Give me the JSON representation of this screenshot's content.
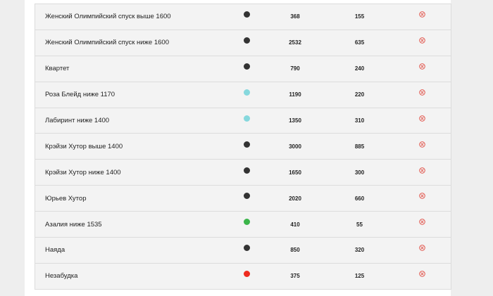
{
  "runs": [
    {
      "name": "Женский Олимпийский спуск выше 1600",
      "status": "black",
      "length": "368",
      "drop": "155"
    },
    {
      "name": "Женский Олимпийский спуск ниже 1600",
      "status": "black",
      "length": "2532",
      "drop": "635"
    },
    {
      "name": "Квартет",
      "status": "black",
      "length": "790",
      "drop": "240"
    },
    {
      "name": "Роза Блейд ниже 1170",
      "status": "light-blue",
      "length": "1190",
      "drop": "220"
    },
    {
      "name": "Лабиринт ниже 1400",
      "status": "light-blue",
      "length": "1350",
      "drop": "310"
    },
    {
      "name": "Крэйзи Хутор выше 1400",
      "status": "black",
      "length": "3000",
      "drop": "885"
    },
    {
      "name": "Крэйзи Хутор ниже 1400",
      "status": "black",
      "length": "1650",
      "drop": "300"
    },
    {
      "name": "Юрьев Хутор",
      "status": "black",
      "length": "2020",
      "drop": "660"
    },
    {
      "name": "Азалия ниже 1535",
      "status": "green",
      "length": "410",
      "drop": "55"
    },
    {
      "name": "Наяда",
      "status": "black",
      "length": "850",
      "drop": "320"
    },
    {
      "name": "Незабудка",
      "status": "red",
      "length": "375",
      "drop": "125"
    }
  ],
  "status_colors": {
    "black": "#333333",
    "light-blue": "#86d8dd",
    "green": "#3bb54a",
    "red": "#ee2b1f"
  },
  "remove_icon": {
    "name": "close-circle-icon",
    "color": "#e0463c"
  }
}
